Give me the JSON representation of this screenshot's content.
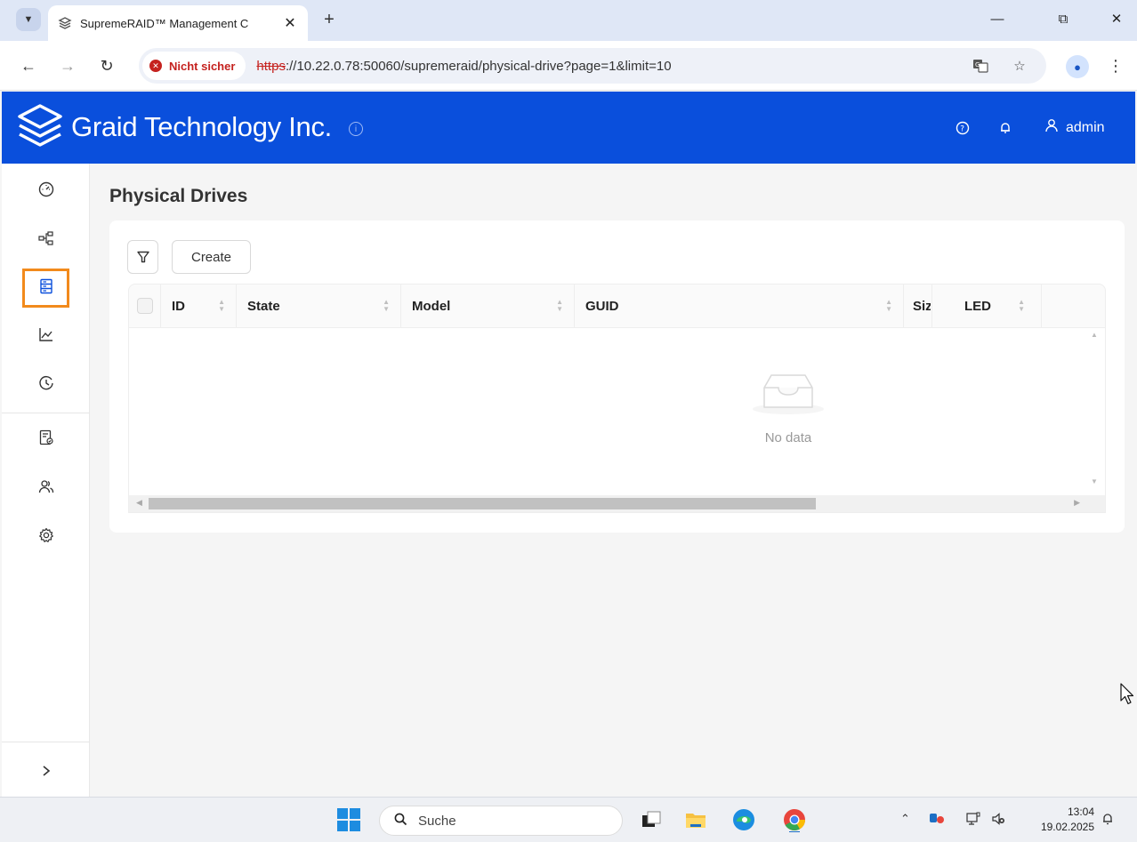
{
  "browser": {
    "tab_title": "SupremeRAID™ Management C",
    "security_label": "Nicht sicher",
    "url_protocol": "https",
    "url_rest": "://10.22.0.78:50060/supremeraid/physical-drive?page=1&limit=10"
  },
  "header": {
    "brand": "Graid Technology Inc.",
    "user": "admin"
  },
  "sidebar": {
    "items": [
      {
        "icon": "dashboard-icon"
      },
      {
        "icon": "topology-icon"
      },
      {
        "icon": "physical-drive-icon",
        "active": true
      },
      {
        "icon": "performance-chart-icon"
      },
      {
        "icon": "history-icon"
      },
      {
        "icon": "license-icon"
      },
      {
        "icon": "users-icon"
      },
      {
        "icon": "settings-icon"
      }
    ]
  },
  "main": {
    "title": "Physical Drives",
    "create_label": "Create",
    "columns": [
      "ID",
      "State",
      "Model",
      "GUID",
      "Siz",
      "LED"
    ],
    "empty_text": "No data"
  },
  "taskbar": {
    "search_placeholder": "Suche",
    "time": "13:04",
    "date": "19.02.2025"
  },
  "colors": {
    "header_blue": "#0a4fdc",
    "highlight_orange": "#f28a1c",
    "insecure_red": "#c5221f"
  }
}
